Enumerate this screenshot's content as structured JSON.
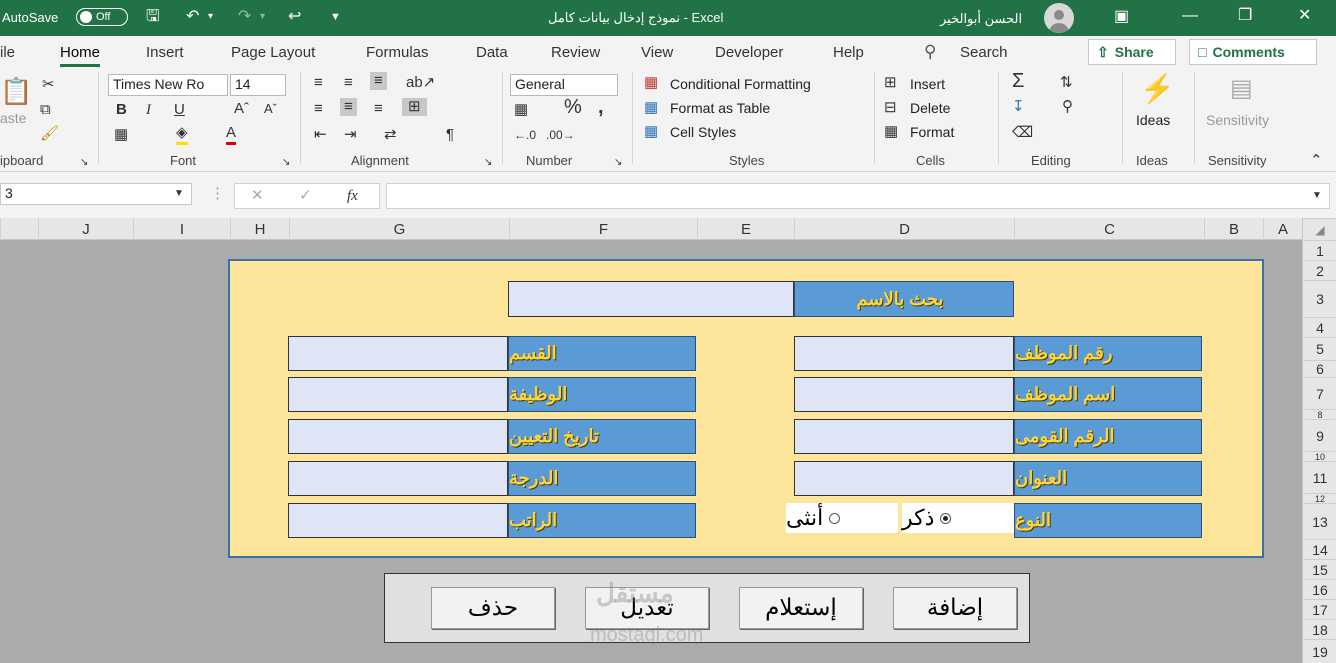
{
  "titlebar": {
    "autosave_label": "AutoSave",
    "autosave_state": "Off",
    "document_title": "نموذج إدخال بيانات كامل  -  Excel",
    "user_name": "الحسن أبوالخير"
  },
  "tabs": [
    "ile",
    "Home",
    "Insert",
    "Page Layout",
    "Formulas",
    "Data",
    "Review",
    "View",
    "Developer",
    "Help"
  ],
  "search_label": "Search",
  "share_label": "Share",
  "comments_label": "Comments",
  "ribbon": {
    "clipboard": {
      "paste": "aste",
      "group": "ipboard"
    },
    "font": {
      "name": "Times New Ro",
      "size": "14",
      "group": "Font"
    },
    "alignment": {
      "group": "Alignment"
    },
    "number": {
      "format": "General",
      "group": "Number"
    },
    "styles": {
      "conditional": "Conditional Formatting",
      "format_table": "Format as Table",
      "cell_styles": "Cell Styles",
      "group": "Styles"
    },
    "cells": {
      "insert": "Insert",
      "delete": "Delete",
      "format": "Format",
      "group": "Cells"
    },
    "editing": {
      "group": "Editing"
    },
    "ideas": {
      "label": "Ideas",
      "group": "Ideas"
    },
    "sensitivity": {
      "label": "Sensitivity",
      "group": "Sensitivity"
    }
  },
  "formula_bar": {
    "name_box": "3",
    "fx": "fx",
    "content": ""
  },
  "columns": [
    "J",
    "I",
    "H",
    "G",
    "F",
    "E",
    "D",
    "C",
    "B",
    "A"
  ],
  "rows": [
    "1",
    "2",
    "3",
    "4",
    "5",
    "6",
    "7",
    "8",
    "9",
    "10",
    "11",
    "12",
    "13",
    "14",
    "15",
    "16",
    "17",
    "18",
    "19"
  ],
  "form": {
    "search_label": "بحث بالاسم",
    "right_labels": [
      "رقم الموظف",
      "اسم الموظف",
      "الرقم القومى",
      "العنوان",
      "النوع"
    ],
    "left_labels": [
      "القسم",
      "الوظيفة",
      "تاريخ التعيين",
      "الدرجة",
      "الراتب"
    ],
    "gender_male": "ذكر",
    "gender_female": "أنثى",
    "gender_selected": "male"
  },
  "buttons": [
    "إضافة",
    "إستعلام",
    "تعديل",
    "حذف"
  ],
  "watermark": {
    "text": "mostaql.com",
    "arabic": "مستقل"
  }
}
